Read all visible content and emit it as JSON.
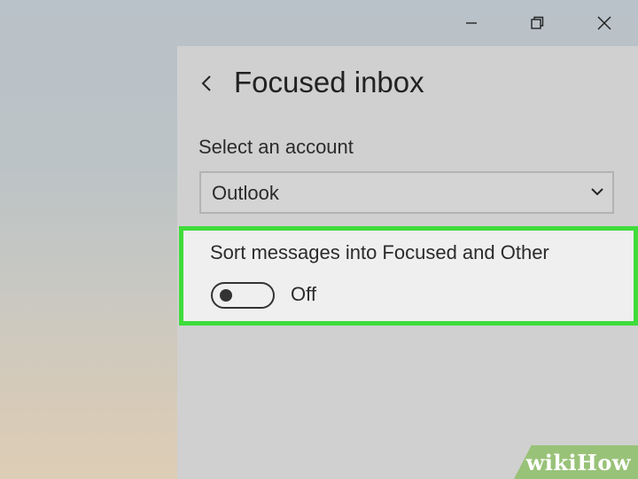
{
  "window_controls": {
    "minimize_icon": "minimize-icon",
    "maximize_icon": "restore-icon",
    "close_icon": "close-icon"
  },
  "header": {
    "back_icon": "chevron-left-icon",
    "title": "Focused inbox"
  },
  "account": {
    "label": "Select an account",
    "selected": "Outlook",
    "chevron_icon": "chevron-down-icon"
  },
  "focused_setting": {
    "label": "Sort messages into Focused and Other",
    "toggle_on": false,
    "state_text": "Off",
    "highlight_color": "#3fdc3a"
  },
  "watermark": {
    "brand_part1": "wiki",
    "brand_part2": "How"
  }
}
